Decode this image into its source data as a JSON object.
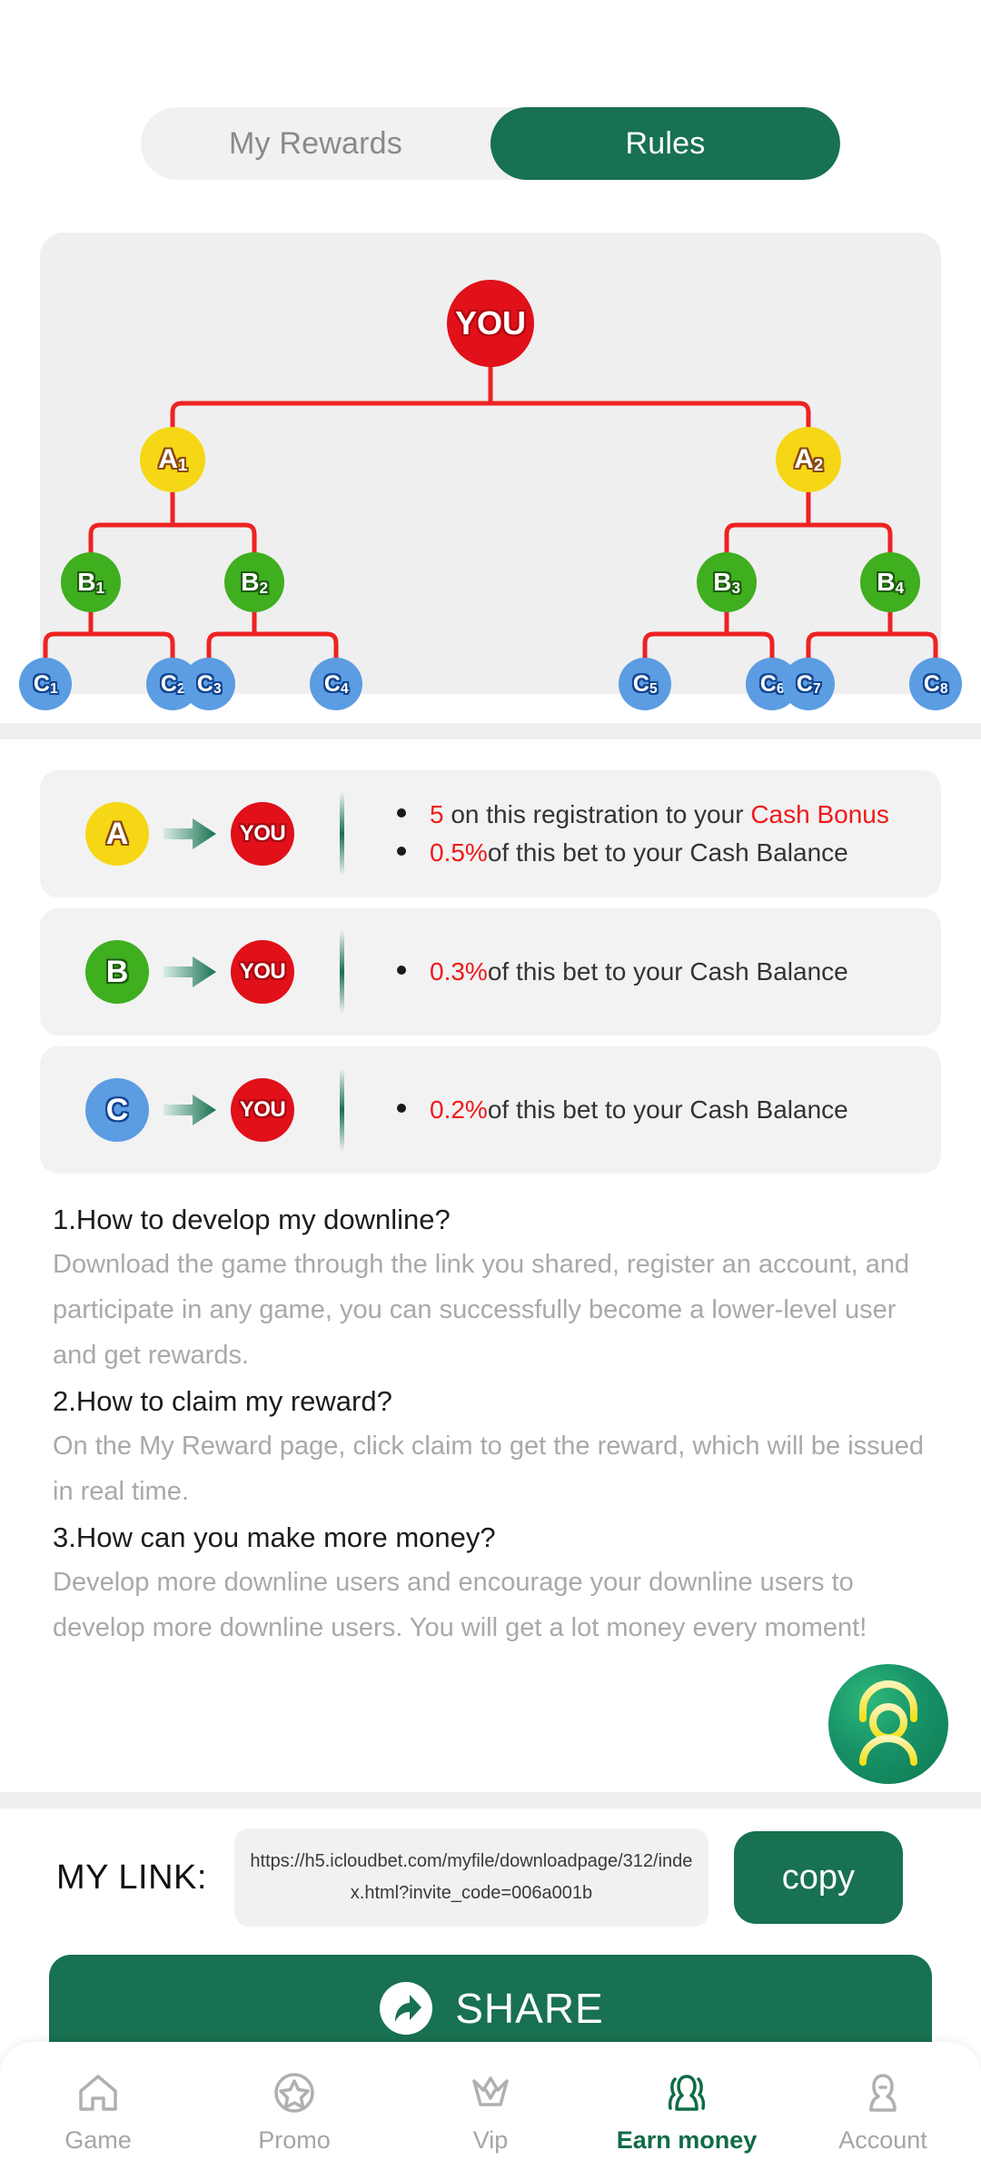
{
  "tabs": [
    {
      "label": "My Rewards",
      "active": false
    },
    {
      "label": "Rules",
      "active": true
    }
  ],
  "tree": {
    "root": {
      "label": "YOU"
    },
    "level_a": [
      {
        "letter": "A",
        "index": "1"
      },
      {
        "letter": "A",
        "index": "2"
      }
    ],
    "level_b": [
      {
        "letter": "B",
        "index": "1"
      },
      {
        "letter": "B",
        "index": "2"
      },
      {
        "letter": "B",
        "index": "3"
      },
      {
        "letter": "B",
        "index": "4"
      }
    ],
    "level_c": [
      {
        "letter": "C",
        "index": "1"
      },
      {
        "letter": "C",
        "index": "2"
      },
      {
        "letter": "C",
        "index": "3"
      },
      {
        "letter": "C",
        "index": "4"
      },
      {
        "letter": "C",
        "index": "5"
      },
      {
        "letter": "C",
        "index": "6"
      },
      {
        "letter": "C",
        "index": "7"
      },
      {
        "letter": "C",
        "index": "8"
      }
    ],
    "line_color": "#ee2222",
    "colors": {
      "you": "#e11019",
      "a": "#f5d716",
      "b": "#3fae1f",
      "c": "#5b9ce2"
    }
  },
  "rewards": [
    {
      "from_badge": "A",
      "to_badge": "YOU",
      "items": [
        {
          "amount": "5",
          "rest": " on this registration to your ",
          "highlight": "Cash Bonus"
        },
        {
          "amount": "0.5%",
          "rest": "of this bet to your Cash Balance",
          "highlight": ""
        }
      ]
    },
    {
      "from_badge": "B",
      "to_badge": "YOU",
      "items": [
        {
          "amount": "0.3%",
          "rest": "of this bet to your Cash Balance",
          "highlight": ""
        }
      ]
    },
    {
      "from_badge": "C",
      "to_badge": "YOU",
      "items": [
        {
          "amount": "0.2%",
          "rest": "of this bet to your Cash Balance",
          "highlight": ""
        }
      ]
    }
  ],
  "faq": [
    {
      "question": "1.How to develop my downline?",
      "answer": "Download the game through the link you shared, register an account, and participate in any game, you can successfully become a lower-level user and get rewards."
    },
    {
      "question": "2.How to claim my reward?",
      "answer": "On the My Reward page, click claim to get the reward, which will be issued in real time."
    },
    {
      "question": "3.How can you make more money?",
      "answer": "Develop more downline users and encourage your downline users to develop more downline users. You will get a lot money every moment!"
    }
  ],
  "my_link": {
    "label": "MY LINK:",
    "url": "https://h5.icloudbet.com/myfile/downloadpage/312/index.html?invite_code=006a001b",
    "copy_label": "copy"
  },
  "share": {
    "label": "SHARE"
  },
  "bottom_nav": [
    {
      "label": "Game",
      "icon": "home-icon",
      "active": false
    },
    {
      "label": "Promo",
      "icon": "star-icon",
      "active": false
    },
    {
      "label": "Vip",
      "icon": "crown-icon",
      "active": false
    },
    {
      "label": "Earn money",
      "icon": "people-icon",
      "active": true
    },
    {
      "label": "Account",
      "icon": "person-icon",
      "active": false
    }
  ],
  "support_fab": {
    "icon": "headset-support-icon"
  },
  "theme": {
    "brand_green": "#187150",
    "accent_red": "#ee1a1a",
    "muted_text": "#a9a9a9"
  }
}
